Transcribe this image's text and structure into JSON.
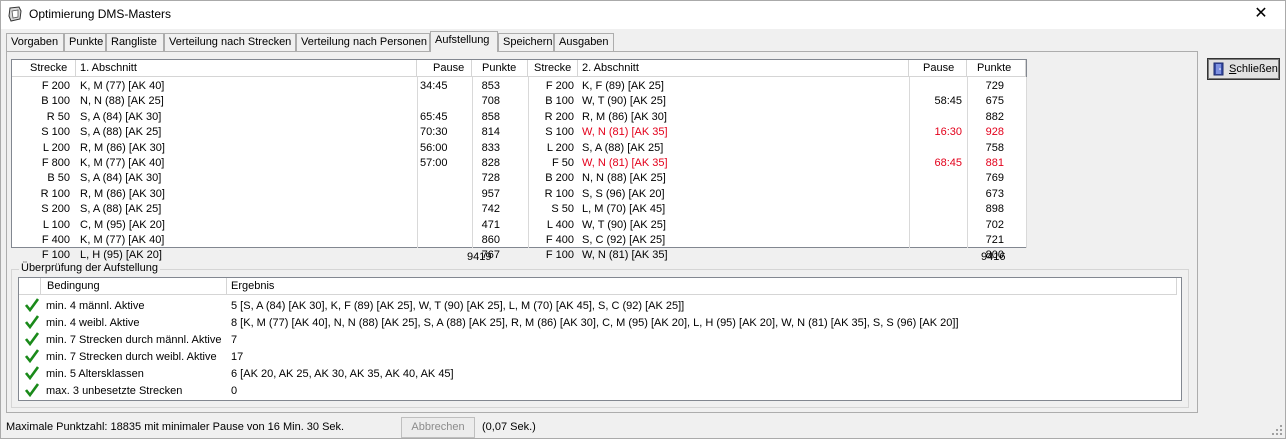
{
  "window": {
    "title": "Optimierung DMS-Masters",
    "close_glyph": "✕"
  },
  "tabs": [
    {
      "label": "Vorgaben",
      "active": false
    },
    {
      "label": "Punkte",
      "active": false
    },
    {
      "label": "Rangliste",
      "active": false
    },
    {
      "label": "Verteilung nach Strecken",
      "active": false
    },
    {
      "label": "Verteilung nach Personen",
      "active": false
    },
    {
      "label": "Aufstellung",
      "active": true
    },
    {
      "label": "Speichern",
      "active": false
    },
    {
      "label": "Ausgaben",
      "active": false
    }
  ],
  "lineup": {
    "headers": {
      "strecke1": "Strecke",
      "abschnitt1": "1. Abschnitt",
      "pause1": "Pause",
      "punkte1": "Punkte",
      "strecke2": "Strecke",
      "abschnitt2": "2. Abschnitt",
      "pause2": "Pause",
      "punkte2": "Punkte"
    },
    "rows": [
      {
        "s1": "F 200",
        "a1": "K, M (77) [AK 40]",
        "p1": "34:45",
        "pt1": "853",
        "s2": "F 200",
        "a2": "K, F (89) [AK 25]",
        "p2": "",
        "pt2": "729",
        "red2": false
      },
      {
        "s1": "B 100",
        "a1": "N, N (88) [AK 25]",
        "p1": "",
        "pt1": "708",
        "s2": "B 100",
        "a2": "W, T (90) [AK 25]",
        "p2": "58:45",
        "pt2": "675",
        "red2": false
      },
      {
        "s1": "R  50",
        "a1": "S, A (84) [AK 30]",
        "p1": "65:45",
        "pt1": "858",
        "s2": "R 200",
        "a2": "R, M (86) [AK 30]",
        "p2": "",
        "pt2": "882",
        "red2": false
      },
      {
        "s1": "S 100",
        "a1": "S, A (88) [AK 25]",
        "p1": "70:30",
        "pt1": "814",
        "s2": "S 100",
        "a2": "W, N (81) [AK 35]",
        "p2": "16:30",
        "pt2": "928",
        "red2": true
      },
      {
        "s1": "L 200",
        "a1": "R, M (86) [AK 30]",
        "p1": "56:00",
        "pt1": "833",
        "s2": "L 200",
        "a2": "S, A (88) [AK 25]",
        "p2": "",
        "pt2": "758",
        "red2": false
      },
      {
        "s1": "F 800",
        "a1": "K, M (77) [AK 40]",
        "p1": "57:00",
        "pt1": "828",
        "s2": "F  50",
        "a2": "W, N (81) [AK 35]",
        "p2": "68:45",
        "pt2": "881",
        "red2": true
      },
      {
        "s1": "B  50",
        "a1": "S, A (84) [AK 30]",
        "p1": "",
        "pt1": "728",
        "s2": "B 200",
        "a2": "N, N (88) [AK 25]",
        "p2": "",
        "pt2": "769",
        "red2": false
      },
      {
        "s1": "R 100",
        "a1": "R, M (86) [AK 30]",
        "p1": "",
        "pt1": "957",
        "s2": "R 100",
        "a2": "S, S (96) [AK 20]",
        "p2": "",
        "pt2": "673",
        "red2": false
      },
      {
        "s1": "S 200",
        "a1": "S, A (88) [AK 25]",
        "p1": "",
        "pt1": "742",
        "s2": "S  50",
        "a2": "L, M (70) [AK 45]",
        "p2": "",
        "pt2": "898",
        "red2": false
      },
      {
        "s1": "L 100",
        "a1": "C, M (95) [AK 20]",
        "p1": "",
        "pt1": "471",
        "s2": "L 400",
        "a2": "W, T (90) [AK 25]",
        "p2": "",
        "pt2": "702",
        "red2": false
      },
      {
        "s1": "F 400",
        "a1": "K, M (77) [AK 40]",
        "p1": "",
        "pt1": "860",
        "s2": "F 400",
        "a2": "S, C (92) [AK 25]",
        "p2": "",
        "pt2": "721",
        "red2": false
      },
      {
        "s1": "F 100",
        "a1": "L, H (95) [AK 20]",
        "p1": "",
        "pt1": "767",
        "s2": "F 100",
        "a2": "W, N (81) [AK 35]",
        "p2": "",
        "pt2": "800",
        "red2": false
      }
    ],
    "total1": "9419",
    "total2": "9416"
  },
  "check": {
    "group_label": "Überprüfung der Aufstellung",
    "headers": {
      "bedingung": "Bedingung",
      "ergebnis": "Ergebnis"
    },
    "rows": [
      {
        "icon": "checkmark-icon",
        "bedingung": "min. 4 männl. Aktive",
        "ergebnis": "5 [S, A (84) [AK 30], K, F (89) [AK 25], W, T (90) [AK 25], L, M (70) [AK 45], S, C (92) [AK 25]]"
      },
      {
        "icon": "checkmark-icon",
        "bedingung": "min. 4 weibl. Aktive",
        "ergebnis": "8 [K, M (77) [AK 40], N, N (88) [AK 25], S, A (88) [AK 25], R, M (86) [AK 30], C, M (95) [AK 20], L, H (95) [AK 20], W, N (81) [AK 35], S, S (96) [AK 20]]"
      },
      {
        "icon": "checkmark-icon",
        "bedingung": "min. 7 Strecken durch männl. Aktive",
        "ergebnis": "7"
      },
      {
        "icon": "checkmark-icon",
        "bedingung": "min. 7 Strecken durch weibl. Aktive",
        "ergebnis": "17"
      },
      {
        "icon": "checkmark-icon",
        "bedingung": "min. 5 Altersklassen",
        "ergebnis": "6 [AK 20, AK 25, AK 30, AK 35, AK 40, AK 45]"
      },
      {
        "icon": "checkmark-icon",
        "bedingung": "max. 3 unbesetzte Strecken",
        "ergebnis": "0"
      }
    ]
  },
  "buttons": {
    "close_first": "S",
    "close_rest": "chließen",
    "abort": "Abbrechen"
  },
  "status": {
    "message": "Maximale Punktzahl:  18835 mit minimaler Pause von 16 Min. 30 Sek.",
    "elapsed": "(0,07 Sek.)"
  },
  "colors": {
    "error_red": "#e3001b",
    "check_green": "#1a8a1a"
  }
}
